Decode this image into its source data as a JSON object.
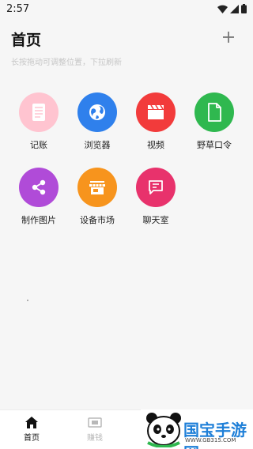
{
  "status_bar": {
    "time": "2:57"
  },
  "header": {
    "title": "首页"
  },
  "hint": "长按拖动可调整位置，下拉刷新",
  "apps": [
    {
      "label": "记账",
      "icon": "notebook-icon",
      "color": "#ffc4d0"
    },
    {
      "label": "浏览器",
      "icon": "globe-icon",
      "color": "#2f80ec"
    },
    {
      "label": "视频",
      "icon": "clapperboard-icon",
      "color": "#f23b3b"
    },
    {
      "label": "野草口令",
      "icon": "document-icon",
      "color": "#2fb84f"
    },
    {
      "label": "制作图片",
      "icon": "share-icon",
      "color": "#b04bd8"
    },
    {
      "label": "设备市场",
      "icon": "store-icon",
      "color": "#f7941d"
    },
    {
      "label": "聊天室",
      "icon": "chat-icon",
      "color": "#e8326c"
    }
  ],
  "bottom_nav": {
    "items": [
      {
        "label": "首页",
        "icon": "home-icon",
        "active": true
      },
      {
        "label": "赚钱",
        "icon": "money-icon",
        "active": false
      }
    ],
    "active_color": "#111111",
    "inactive_color": "#b8b8b8"
  },
  "watermark": {
    "text": "国宝手游网",
    "url": "WWW.GB315.COM"
  }
}
